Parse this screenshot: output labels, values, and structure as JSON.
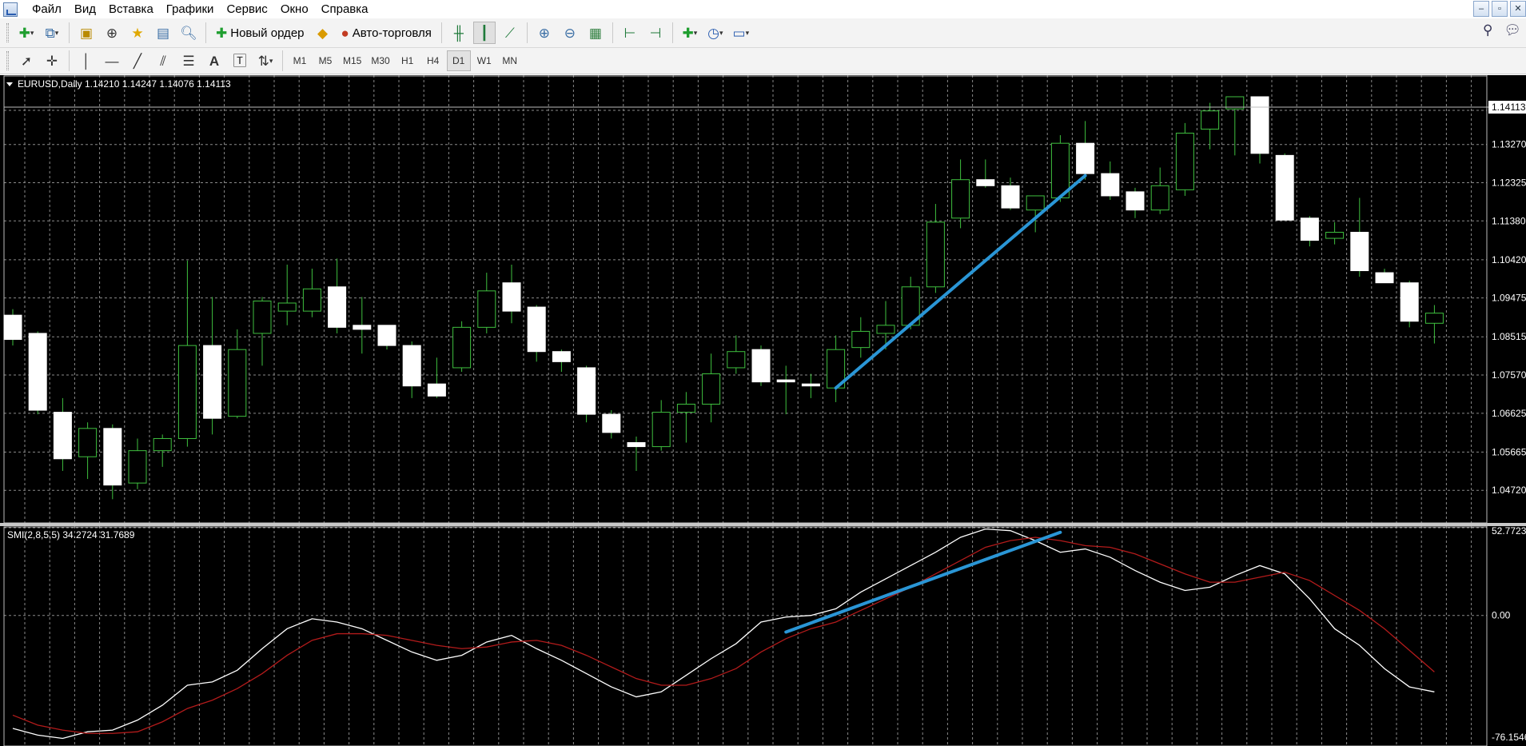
{
  "menu": [
    "Файл",
    "Вид",
    "Вставка",
    "Графики",
    "Сервис",
    "Окно",
    "Справка"
  ],
  "window_controls": [
    "–",
    "▫",
    "✕"
  ],
  "toolbar": {
    "new_order_label": "Новый ордер",
    "auto_trading_label": "Авто-торговля"
  },
  "timeframes": [
    "M1",
    "M5",
    "M15",
    "M30",
    "H1",
    "H4",
    "D1",
    "W1",
    "MN"
  ],
  "active_timeframe": "D1",
  "chart": {
    "symbol_header": "EURUSD,Daily  1.14210 1.14247 1.14076 1.14113",
    "price_labels": [
      "1.14113",
      "1.13270",
      "1.12325",
      "1.11380",
      "1.10420",
      "1.09475",
      "1.08515",
      "1.07570",
      "1.06625",
      "1.05665",
      "1.04720"
    ],
    "current_price": "1.14113",
    "indicator_header": "SMI(2,8,5,5) 34.2724 31.7689",
    "indicator_labels": [
      "52.7723",
      "0.00",
      "-76.1546"
    ],
    "colors": {
      "background": "#000000",
      "grid": "#8a8a8a",
      "bull_outline": "#3fbf3f",
      "bear_body": "#ffffff",
      "wick": "#3fbf3f",
      "trendline": "#2a96d6",
      "smi_main": "#ffffff",
      "smi_signal": "#b31b1b"
    }
  },
  "chart_data": [
    {
      "type": "candlestick",
      "title": "EURUSD,Daily",
      "ylim": [
        1.0425,
        1.1445
      ],
      "candles": [
        {
          "o": 1.0905,
          "h": 1.092,
          "l": 1.083,
          "c": 1.0845
        },
        {
          "o": 1.086,
          "h": 1.0865,
          "l": 1.066,
          "c": 1.067
        },
        {
          "o": 1.0665,
          "h": 1.07,
          "l": 1.052,
          "c": 1.055
        },
        {
          "o": 1.0555,
          "h": 1.064,
          "l": 1.05,
          "c": 1.0625
        },
        {
          "o": 1.0625,
          "h": 1.0635,
          "l": 1.045,
          "c": 1.0485
        },
        {
          "o": 1.049,
          "h": 1.06,
          "l": 1.0475,
          "c": 1.057
        },
        {
          "o": 1.057,
          "h": 1.061,
          "l": 1.053,
          "c": 1.06
        },
        {
          "o": 1.06,
          "h": 1.104,
          "l": 1.058,
          "c": 1.083
        },
        {
          "o": 1.083,
          "h": 1.095,
          "l": 1.061,
          "c": 1.065
        },
        {
          "o": 1.0655,
          "h": 1.087,
          "l": 1.065,
          "c": 1.082
        },
        {
          "o": 1.086,
          "h": 1.095,
          "l": 1.078,
          "c": 1.094
        },
        {
          "o": 1.0915,
          "h": 1.103,
          "l": 1.088,
          "c": 1.0935
        },
        {
          "o": 1.0915,
          "h": 1.102,
          "l": 1.09,
          "c": 1.097
        },
        {
          "o": 1.0975,
          "h": 1.1045,
          "l": 1.086,
          "c": 1.0875
        },
        {
          "o": 1.088,
          "h": 1.095,
          "l": 1.081,
          "c": 1.087
        },
        {
          "o": 1.088,
          "h": 1.088,
          "l": 1.082,
          "c": 1.083
        },
        {
          "o": 1.083,
          "h": 1.084,
          "l": 1.07,
          "c": 1.073
        },
        {
          "o": 1.0735,
          "h": 1.08,
          "l": 1.07,
          "c": 1.0705
        },
        {
          "o": 1.0775,
          "h": 1.089,
          "l": 1.0765,
          "c": 1.0875
        },
        {
          "o": 1.0875,
          "h": 1.101,
          "l": 1.086,
          "c": 1.0965
        },
        {
          "o": 1.0985,
          "h": 1.103,
          "l": 1.0885,
          "c": 1.0915
        },
        {
          "o": 1.0925,
          "h": 1.093,
          "l": 1.079,
          "c": 1.0815
        },
        {
          "o": 1.0815,
          "h": 1.082,
          "l": 1.0765,
          "c": 1.079
        },
        {
          "o": 1.0775,
          "h": 1.078,
          "l": 1.064,
          "c": 1.066
        },
        {
          "o": 1.066,
          "h": 1.067,
          "l": 1.06,
          "c": 1.0615
        },
        {
          "o": 1.059,
          "h": 1.0605,
          "l": 1.052,
          "c": 1.058
        },
        {
          "o": 1.058,
          "h": 1.0695,
          "l": 1.057,
          "c": 1.0665
        },
        {
          "o": 1.0665,
          "h": 1.0715,
          "l": 1.059,
          "c": 1.0685
        },
        {
          "o": 1.0685,
          "h": 1.081,
          "l": 1.064,
          "c": 1.076
        },
        {
          "o": 1.0775,
          "h": 1.0855,
          "l": 1.076,
          "c": 1.0815
        },
        {
          "o": 1.082,
          "h": 1.083,
          "l": 1.073,
          "c": 1.074
        },
        {
          "o": 1.0745,
          "h": 1.078,
          "l": 1.066,
          "c": 1.074
        },
        {
          "o": 1.0735,
          "h": 1.076,
          "l": 1.07,
          "c": 1.073
        },
        {
          "o": 1.0725,
          "h": 1.0855,
          "l": 1.069,
          "c": 1.082
        },
        {
          "o": 1.0825,
          "h": 1.09,
          "l": 1.08,
          "c": 1.0865
        },
        {
          "o": 1.086,
          "h": 1.094,
          "l": 1.082,
          "c": 1.088
        },
        {
          "o": 1.088,
          "h": 1.1,
          "l": 1.087,
          "c": 1.0975
        },
        {
          "o": 1.0975,
          "h": 1.118,
          "l": 1.096,
          "c": 1.1135
        },
        {
          "o": 1.1145,
          "h": 1.129,
          "l": 1.112,
          "c": 1.124
        },
        {
          "o": 1.124,
          "h": 1.129,
          "l": 1.122,
          "c": 1.1225
        },
        {
          "o": 1.1225,
          "h": 1.1245,
          "l": 1.1165,
          "c": 1.117
        },
        {
          "o": 1.1165,
          "h": 1.12,
          "l": 1.111,
          "c": 1.12
        },
        {
          "o": 1.1195,
          "h": 1.135,
          "l": 1.1185,
          "c": 1.133
        },
        {
          "o": 1.133,
          "h": 1.1385,
          "l": 1.124,
          "c": 1.1255
        },
        {
          "o": 1.1255,
          "h": 1.1285,
          "l": 1.119,
          "c": 1.12
        },
        {
          "o": 1.121,
          "h": 1.122,
          "l": 1.1145,
          "c": 1.1165
        },
        {
          "o": 1.1165,
          "h": 1.127,
          "l": 1.1155,
          "c": 1.1225
        },
        {
          "o": 1.1215,
          "h": 1.138,
          "l": 1.12,
          "c": 1.1355
        },
        {
          "o": 1.1365,
          "h": 1.143,
          "l": 1.1315,
          "c": 1.141
        },
        {
          "o": 1.1415,
          "h": 1.144,
          "l": 1.13,
          "c": 1.1445
        },
        {
          "o": 1.1445,
          "h": 1.1445,
          "l": 1.128,
          "c": 1.1305
        },
        {
          "o": 1.13,
          "h": 1.1305,
          "l": 1.114,
          "c": 1.114
        },
        {
          "o": 1.1145,
          "h": 1.115,
          "l": 1.1075,
          "c": 1.109
        },
        {
          "o": 1.1095,
          "h": 1.1135,
          "l": 1.108,
          "c": 1.111
        },
        {
          "o": 1.111,
          "h": 1.1195,
          "l": 1.1,
          "c": 1.1015
        },
        {
          "o": 1.101,
          "h": 1.102,
          "l": 1.0995,
          "c": 1.0985
        },
        {
          "o": 1.0985,
          "h": 1.099,
          "l": 1.0875,
          "c": 1.089
        },
        {
          "o": 1.0885,
          "h": 1.093,
          "l": 1.0835,
          "c": 1.091
        }
      ],
      "trendline": {
        "from_index": 33,
        "from_value": 1.0725,
        "to_index": 43,
        "to_value": 1.125
      }
    },
    {
      "type": "line",
      "title": "SMI(2,8,5,5)",
      "ylim": [
        -76.1546,
        52.7723
      ],
      "series": [
        {
          "name": "SMI",
          "color": "#ffffff",
          "values": [
            -68,
            -72,
            -74,
            -70,
            -69,
            -63,
            -54,
            -42,
            -40,
            -33,
            -20,
            -8,
            -2,
            -4,
            -8,
            -15,
            -22,
            -27,
            -24,
            -16,
            -12,
            -20,
            -27,
            -35,
            -43,
            -49,
            -46,
            -36,
            -26,
            -17,
            -4,
            -1,
            0,
            4,
            14,
            22,
            30,
            38,
            47,
            52,
            51,
            45,
            38,
            40,
            35,
            27,
            20,
            15,
            17,
            24,
            30,
            25,
            10,
            -8,
            -18,
            -32,
            -43,
            -46
          ]
        },
        {
          "name": "Signal",
          "color": "#b31b1b",
          "values": [
            -60,
            -66,
            -69,
            -71,
            -71,
            -70,
            -64,
            -56,
            -51,
            -44,
            -35,
            -24,
            -15,
            -11,
            -11,
            -12,
            -15,
            -18,
            -20,
            -19,
            -16,
            -15,
            -18,
            -24,
            -31,
            -38,
            -42,
            -42,
            -38,
            -32,
            -22,
            -14,
            -8,
            -4,
            3,
            10,
            17,
            25,
            33,
            41,
            45,
            47,
            45,
            42,
            41,
            37,
            31,
            25,
            20,
            20,
            23,
            26,
            21,
            12,
            3,
            -8,
            -21,
            -34
          ]
        }
      ],
      "trendline": {
        "from_index": 31,
        "from_value": -10,
        "to_index": 42,
        "to_value": 50
      }
    }
  ]
}
